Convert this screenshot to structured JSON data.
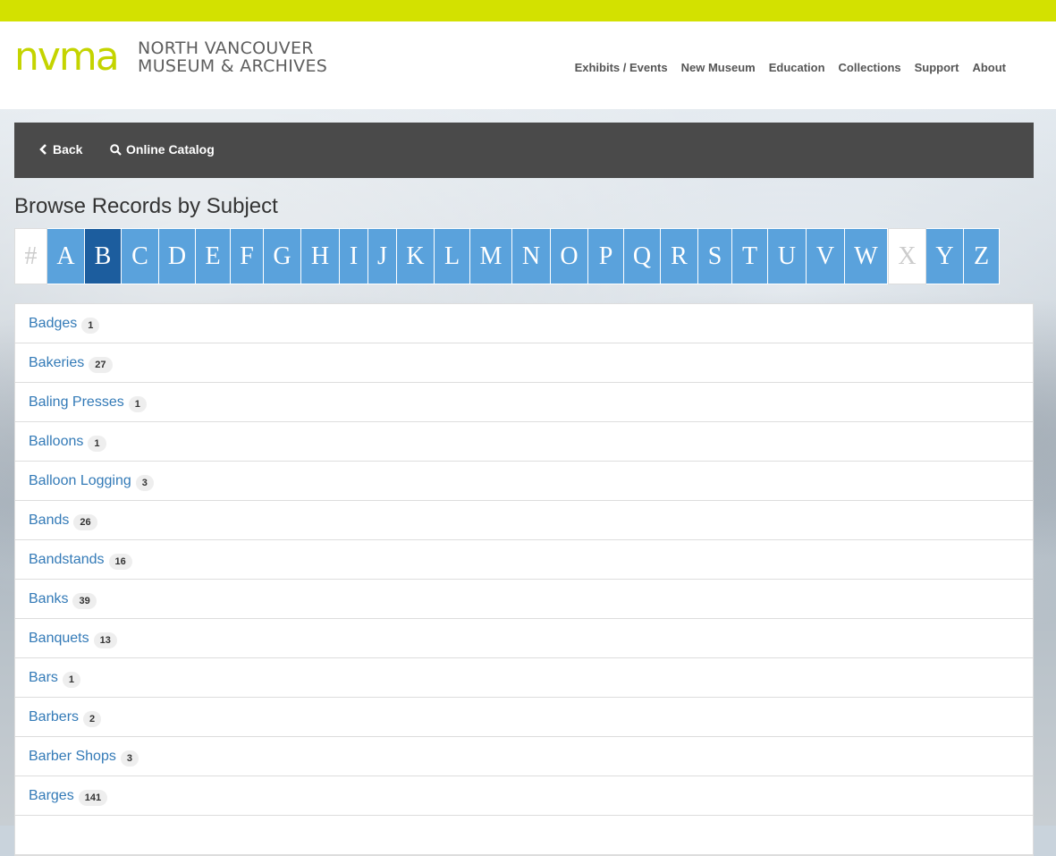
{
  "header": {
    "logo_mark": "nvma",
    "logo_line1": "NORTH VANCOUVER",
    "logo_line2": "MUSEUM & ARCHIVES",
    "nav": [
      "Exhibits / Events",
      "New Museum",
      "Education",
      "Collections",
      "Support",
      "About"
    ]
  },
  "toolbar": {
    "back_label": "Back",
    "catalog_label": "Online Catalog"
  },
  "page_title": "Browse Records by Subject",
  "letters": [
    {
      "label": "#",
      "state": "disabled"
    },
    {
      "label": "A",
      "state": "link"
    },
    {
      "label": "B",
      "state": "active"
    },
    {
      "label": "C",
      "state": "link"
    },
    {
      "label": "D",
      "state": "link"
    },
    {
      "label": "E",
      "state": "link"
    },
    {
      "label": "F",
      "state": "link"
    },
    {
      "label": "G",
      "state": "link"
    },
    {
      "label": "H",
      "state": "link"
    },
    {
      "label": "I",
      "state": "link"
    },
    {
      "label": "J",
      "state": "link"
    },
    {
      "label": "K",
      "state": "link"
    },
    {
      "label": "L",
      "state": "link"
    },
    {
      "label": "M",
      "state": "link"
    },
    {
      "label": "N",
      "state": "link"
    },
    {
      "label": "O",
      "state": "link"
    },
    {
      "label": "P",
      "state": "link"
    },
    {
      "label": "Q",
      "state": "link"
    },
    {
      "label": "R",
      "state": "link"
    },
    {
      "label": "S",
      "state": "link"
    },
    {
      "label": "T",
      "state": "link"
    },
    {
      "label": "U",
      "state": "link"
    },
    {
      "label": "V",
      "state": "link"
    },
    {
      "label": "W",
      "state": "link"
    },
    {
      "label": "X",
      "state": "disabled"
    },
    {
      "label": "Y",
      "state": "link"
    },
    {
      "label": "Z",
      "state": "link"
    }
  ],
  "subjects": [
    {
      "name": "Badges",
      "count": "1"
    },
    {
      "name": "Bakeries",
      "count": "27"
    },
    {
      "name": "Baling Presses",
      "count": "1"
    },
    {
      "name": "Balloons",
      "count": "1"
    },
    {
      "name": "Balloon Logging",
      "count": "3"
    },
    {
      "name": "Bands",
      "count": "26"
    },
    {
      "name": "Bandstands",
      "count": "16"
    },
    {
      "name": "Banks",
      "count": "39"
    },
    {
      "name": "Banquets",
      "count": "13"
    },
    {
      "name": "Bars",
      "count": "1"
    },
    {
      "name": "Barbers",
      "count": "2"
    },
    {
      "name": "Barber Shops",
      "count": "3"
    },
    {
      "name": "Barges",
      "count": "141"
    },
    {
      "name": "",
      "count": ""
    }
  ],
  "colors": {
    "accent_bar": "#d3e100",
    "logo_green": "#c4d400",
    "toolbar": "#4a4a4a",
    "letter_link": "#5aa2dc",
    "letter_active": "#1c5d9e",
    "link_text": "#337ab7"
  }
}
